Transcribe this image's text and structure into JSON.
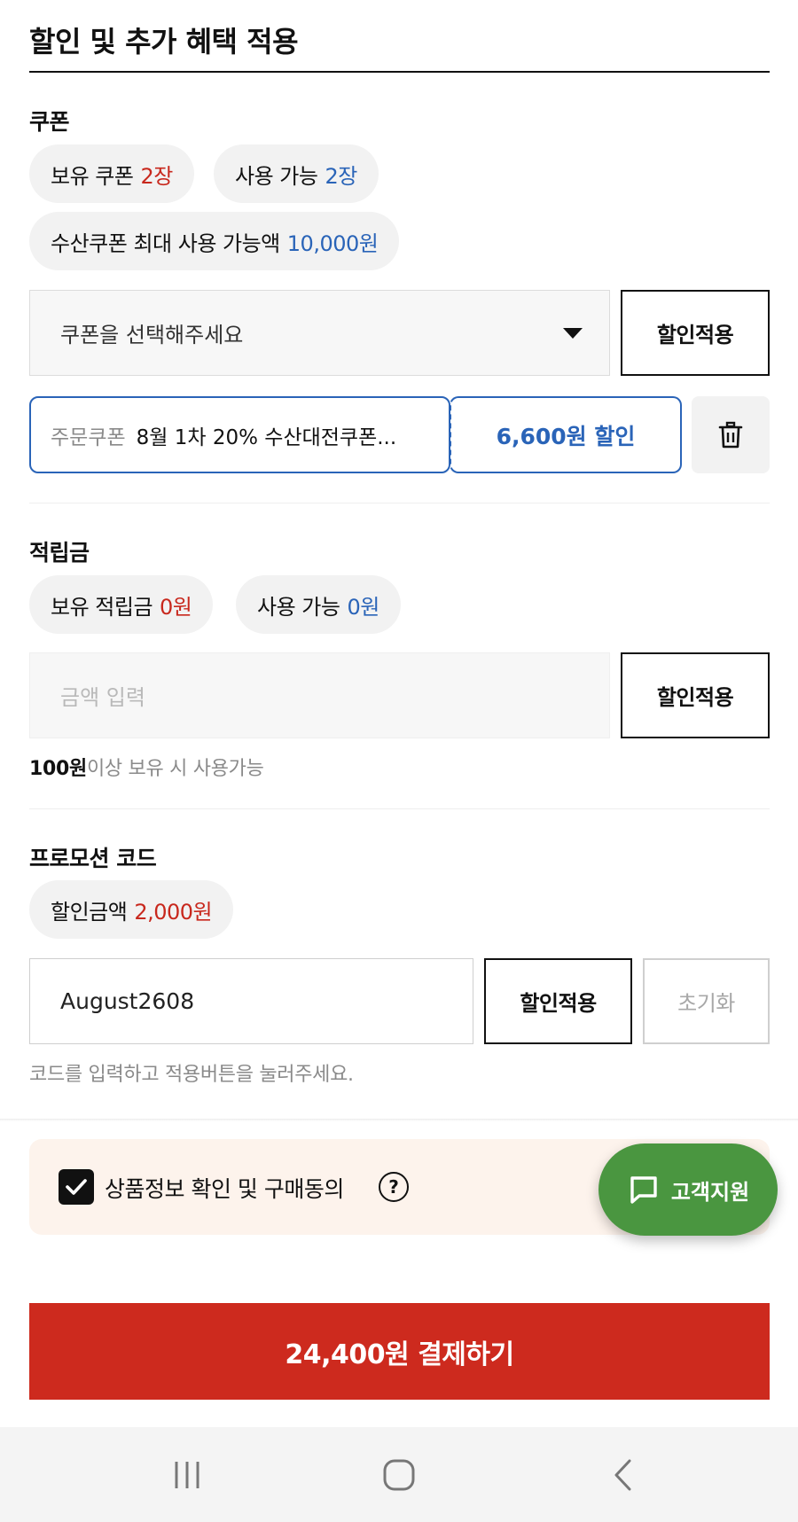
{
  "header": {
    "title": "할인 및 추가 혜택 적용"
  },
  "coupon": {
    "label": "쿠폰",
    "owned_label": "보유 쿠폰",
    "owned_value": "2장",
    "usable_label": "사용 가능",
    "usable_value": "2장",
    "max_label": "수산쿠폰 최대 사용 가능액",
    "max_value": "10,000원",
    "select_placeholder": "쿠폰을 선택해주세요",
    "apply_label": "할인적용",
    "applied": {
      "tag": "주문쿠폰",
      "name": "8월 1차 20% 수산대전쿠폰...",
      "discount": "6,600원 할인"
    }
  },
  "points": {
    "label": "적립금",
    "owned_label": "보유 적립금",
    "owned_value": "0원",
    "usable_label": "사용 가능",
    "usable_value": "0원",
    "input_placeholder": "금액 입력",
    "apply_label": "할인적용",
    "hint_strong": "100원",
    "hint_rest": "이상 보유 시 사용가능"
  },
  "promo": {
    "label": "프로모션 코드",
    "discount_label": "할인금액",
    "discount_value": "2,000원",
    "code_value": "August2608",
    "apply_label": "할인적용",
    "reset_label": "초기화",
    "hint": "코드를 입력하고 적용버튼을 눌러주세요."
  },
  "agreement": {
    "label": "상품정보 확인 및 구매동의",
    "checked": true,
    "help": "?"
  },
  "support": {
    "label": "고객지원"
  },
  "payment": {
    "button_label": "24,400원 결제하기",
    "color": "#cd2a1e"
  },
  "colors": {
    "red": "#c8281d",
    "blue": "#2a64b8",
    "support_green": "#4a9640"
  },
  "icons": [
    "caret-down-icon",
    "trash-icon",
    "check-icon",
    "help-icon",
    "chat-bubble-icon",
    "recent-apps-icon",
    "home-icon",
    "back-icon"
  ]
}
